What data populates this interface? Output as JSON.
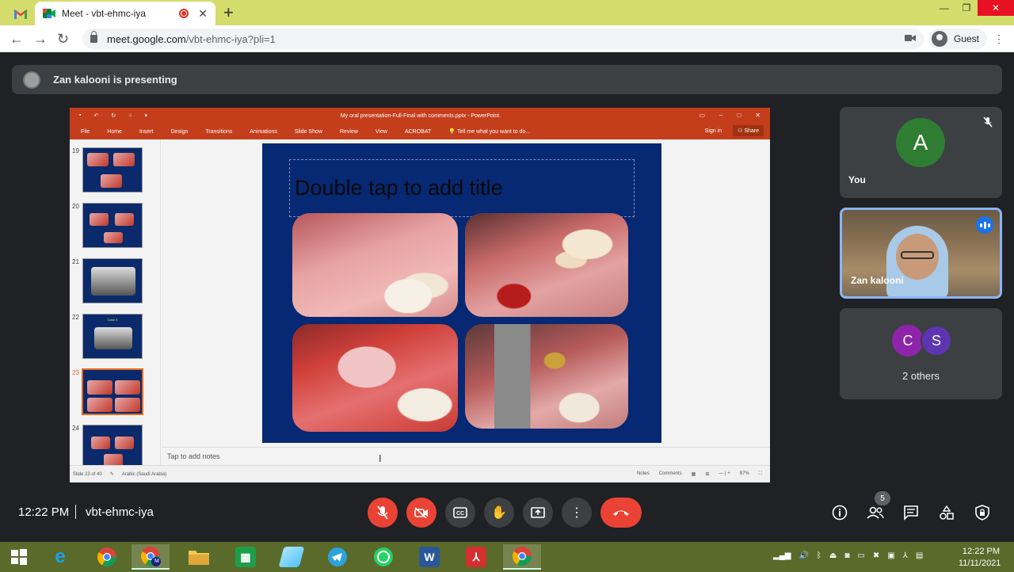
{
  "browser": {
    "tab_title": "Meet - vbt-ehmc-iya",
    "url_host": "meet.google.com",
    "url_path": "/vbt-ehmc-iya?pli=1",
    "profile_label": "Guest",
    "new_tab_glyph": "+",
    "close_glyph": "✕"
  },
  "meet": {
    "presenting_text": "Zan kalooni is presenting",
    "time": "12:22 PM",
    "meeting_code": "vbt-ehmc-iya",
    "participants_badge": "5",
    "tiles": {
      "you_initial": "A",
      "you_label": "You",
      "zan_label": "Zan kalooni",
      "others_initials": [
        "C",
        "S"
      ],
      "others_label": "2 others"
    }
  },
  "powerpoint": {
    "window_title": "My oral presentation-Full-Final with comments.pptx - PowerPoint",
    "ribbon_tabs": [
      "File",
      "Home",
      "Insert",
      "Design",
      "Transitions",
      "Animations",
      "Slide Show",
      "Review",
      "View",
      "ACROBAT"
    ],
    "tell_me": "Tell me what you want to do...",
    "sign_in": "Sign in",
    "share": "Share",
    "thumbnail_numbers": [
      "19",
      "20",
      "21",
      "22",
      "23",
      "24"
    ],
    "case_label": "Case 2",
    "slide_title_placeholder": "Double tap to add title",
    "notes_placeholder": "Tap to add notes",
    "status_slide": "Slide 23 of 40",
    "status_language": "Arabic (Saudi Arabia)",
    "status_notes": "Notes",
    "status_comments": "Comments",
    "zoom": "87%"
  },
  "taskbar": {
    "clock_time": "12:22 PM",
    "clock_date": "11/11/2021",
    "word_label": "W",
    "chrome_badge": "M"
  },
  "colors": {
    "meet_bg": "#202124",
    "tile_bg": "#3c4043",
    "ppt_accent": "#c43e1c",
    "slide_bg": "#072873",
    "red_control": "#ea4335",
    "browser_tabbar": "#d4dc6c",
    "taskbar": "#5a6a2a"
  },
  "icons": [
    "gmail-icon",
    "meet-icon",
    "recording-icon",
    "camera-off-icon",
    "mic-off-icon",
    "speaking-icon",
    "captions-icon",
    "raise-hand-icon",
    "present-icon",
    "more-options-icon",
    "hang-up-icon",
    "info-icon",
    "people-icon",
    "chat-icon",
    "activities-icon",
    "host-controls-icon"
  ]
}
